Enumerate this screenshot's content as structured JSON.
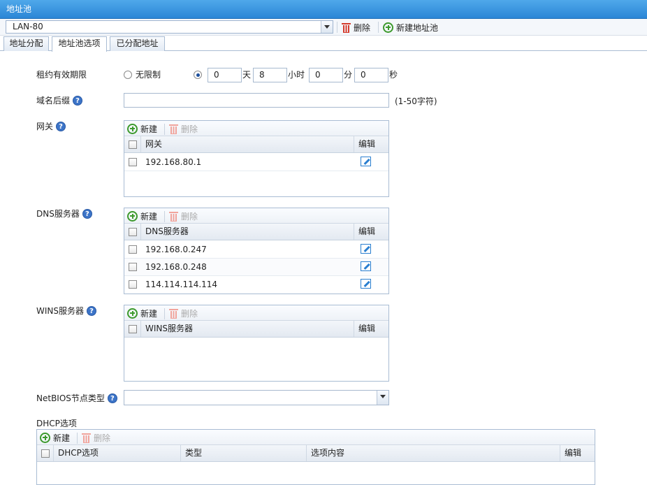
{
  "window": {
    "title": "地址池"
  },
  "toolbar": {
    "pool_selected": "LAN-80",
    "delete_label": "删除",
    "new_pool_label": "新建地址池"
  },
  "tabs": [
    {
      "label": "地址分配",
      "active": false
    },
    {
      "label": "地址池选项",
      "active": true
    },
    {
      "label": "已分配地址",
      "active": false
    }
  ],
  "lease": {
    "label": "租约有效期限",
    "unlimited_label": "无限制",
    "unlimited_selected": false,
    "days": "0",
    "days_unit": "天",
    "hours": "8",
    "hours_unit": "小时",
    "minutes": "0",
    "minutes_unit": "分",
    "seconds": "0",
    "seconds_unit": "秒"
  },
  "domain_suffix": {
    "label": "域名后缀",
    "value": "",
    "hint": "(1-50字符)"
  },
  "grid_buttons": {
    "new": "新建",
    "delete": "删除"
  },
  "gateway": {
    "label": "网关",
    "columns": [
      "网关",
      "编辑"
    ],
    "rows": [
      "192.168.80.1"
    ]
  },
  "dns": {
    "label": "DNS服务器",
    "columns": [
      "DNS服务器",
      "编辑"
    ],
    "rows": [
      "192.168.0.247",
      "192.168.0.248",
      "114.114.114.114"
    ]
  },
  "wins": {
    "label": "WINS服务器",
    "columns": [
      "WINS服务器",
      "编辑"
    ],
    "rows": []
  },
  "netbios": {
    "label": "NetBIOS节点类型",
    "value": ""
  },
  "dhcp_options": {
    "label": "DHCP选项",
    "columns": [
      "DHCP选项",
      "类型",
      "选项内容",
      "编辑"
    ],
    "rows": []
  },
  "colors": {
    "titlebar": "#2b86d6",
    "accent_blue": "#3c74c8",
    "add_green": "#3d9a2d",
    "delete_red": "#d43b2d"
  },
  "icons": [
    "trash-icon",
    "add-circle-icon",
    "help-icon",
    "edit-icon",
    "chevron-down-icon"
  ]
}
